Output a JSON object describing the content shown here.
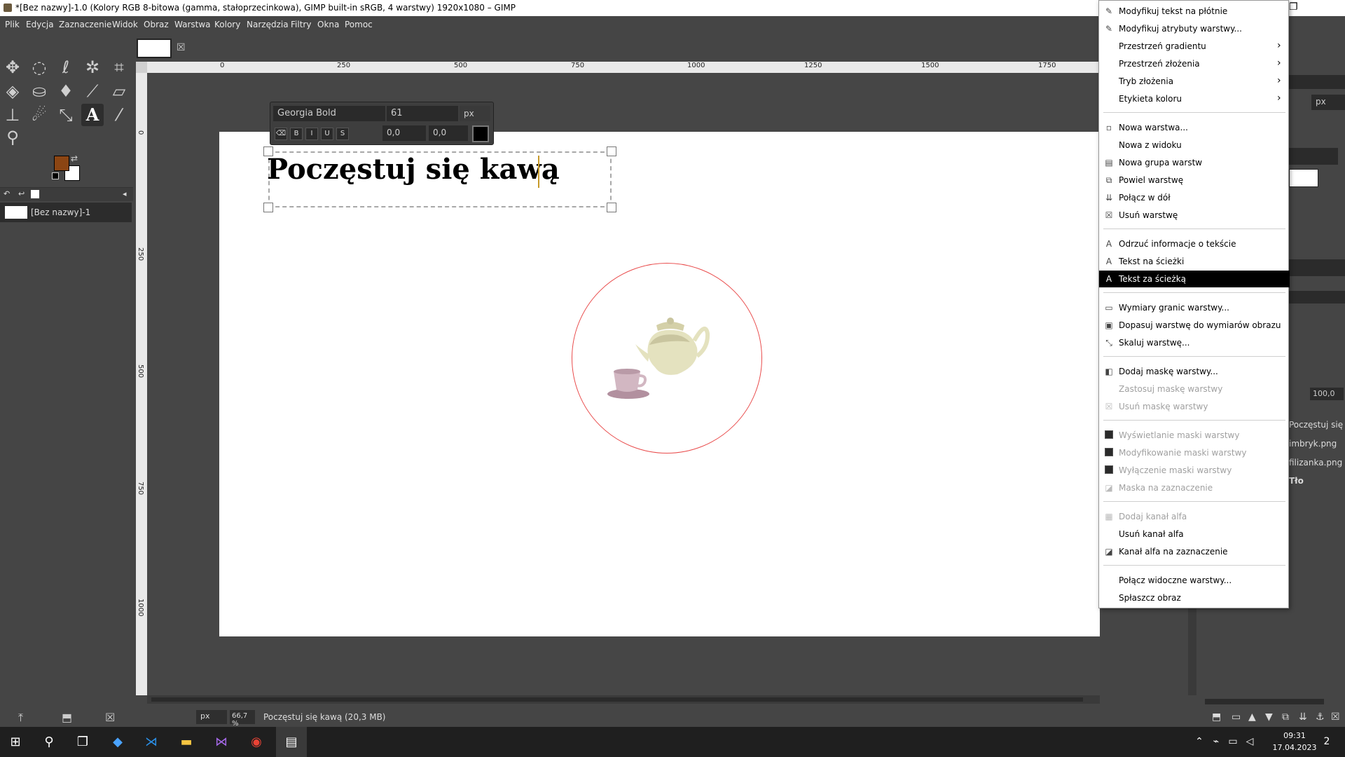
{
  "window": {
    "title": "*[Bez nazwy]-1.0 (Kolory RGB 8-bitowa (gamma, stałoprzecinkowa), GIMP built-in sRGB, 4 warstwy) 1920x1080 – GIMP",
    "restore_icon": "restore-icon"
  },
  "menubar": [
    "Plik",
    "Edycja",
    "Zaznaczenie",
    "Widok",
    "Obraz",
    "Warstwa",
    "Kolory",
    "Narzędzia",
    "Filtry",
    "Okna",
    "Pomoc"
  ],
  "toolbox": {
    "tools": [
      "move-icon",
      "ellipse-select-icon",
      "free-select-icon",
      "fuzzy-select-icon",
      "crop-icon",
      "transform-icon",
      "bucket-fill-icon",
      "ink-icon",
      "paintbrush-icon",
      "eraser-icon",
      "clone-icon",
      "smudge-icon",
      "paths-icon",
      "text-tool-icon",
      "color-picker-icon",
      "zoom-icon"
    ],
    "active_tool": "text-tool-icon",
    "fg_color": "#8b4513",
    "bg_color": "#ffffff"
  },
  "images_panel": {
    "item_label": "[Bez nazwy]-1"
  },
  "rulers": {
    "h_ticks": [
      "0",
      "250",
      "500",
      "750",
      "1000",
      "1250",
      "1500",
      "1750"
    ],
    "v_ticks": [
      "0",
      "250",
      "500",
      "750",
      "1000"
    ]
  },
  "text_tool_options": {
    "font": "Georgia Bold",
    "size": "61",
    "unit": "px",
    "kerning": "0,0",
    "baseline": "0,0",
    "color": "#000000"
  },
  "canvas": {
    "headline": "Poczęstuj się kawą"
  },
  "statusbar": {
    "unit": "px",
    "zoom": "66,7 %",
    "message": "Poczęstuj się kawą (20,3 MB)"
  },
  "right_dock": {
    "unit": "px",
    "opacity": "100,0",
    "layers": [
      "Poczęstuj się k",
      "imbryk.png",
      "filizanka.png",
      "Tło"
    ]
  },
  "context_menu": {
    "items": [
      {
        "label": "Modyfikuj tekst na płótnie",
        "icon": "edit-text-icon",
        "state": "normal"
      },
      {
        "label": "Modyfikuj atrybuty warstwy...",
        "icon": "edit-attrs-icon",
        "state": "normal"
      },
      {
        "label": "Przestrzeń gradientu",
        "icon": "",
        "state": "submenu"
      },
      {
        "label": "Przestrzeń złożenia",
        "icon": "",
        "state": "submenu"
      },
      {
        "label": "Tryb złożenia",
        "icon": "",
        "state": "submenu"
      },
      {
        "label": "Etykieta koloru",
        "icon": "",
        "state": "submenu"
      },
      {
        "label": "Nowa warstwa...",
        "icon": "new-layer-icon",
        "state": "normal"
      },
      {
        "label": "Nowa z widoku",
        "icon": "",
        "state": "normal"
      },
      {
        "label": "Nowa grupa warstw",
        "icon": "new-group-icon",
        "state": "normal"
      },
      {
        "label": "Powiel warstwę",
        "icon": "duplicate-icon",
        "state": "normal"
      },
      {
        "label": "Połącz w dół",
        "icon": "merge-down-icon",
        "state": "normal"
      },
      {
        "label": "Usuń warstwę",
        "icon": "delete-layer-icon",
        "state": "normal"
      },
      {
        "label": "Odrzuć informacje o tekście",
        "icon": "text-a-icon",
        "state": "normal"
      },
      {
        "label": "Tekst na ścieżki",
        "icon": "text-a-icon",
        "state": "normal"
      },
      {
        "label": "Tekst za ścieżką",
        "icon": "text-a-icon",
        "state": "highlighted"
      },
      {
        "label": "Wymiary granic warstwy...",
        "icon": "layer-bounds-icon",
        "state": "normal"
      },
      {
        "label": "Dopasuj warstwę do wymiarów obrazu",
        "icon": "fit-layer-icon",
        "state": "normal"
      },
      {
        "label": "Skaluj warstwę...",
        "icon": "scale-layer-icon",
        "state": "normal"
      },
      {
        "label": "Dodaj maskę warstwy...",
        "icon": "add-mask-icon",
        "state": "normal"
      },
      {
        "label": "Zastosuj maskę warstwy",
        "icon": "",
        "state": "disabled"
      },
      {
        "label": "Usuń maskę warstwy",
        "icon": "delete-mask-icon",
        "state": "disabled"
      },
      {
        "label": "Wyświetlanie maski warstwy",
        "icon": "checkbox-icon",
        "state": "disabled"
      },
      {
        "label": "Modyfikowanie maski warstwy",
        "icon": "checkbox-icon",
        "state": "disabled"
      },
      {
        "label": "Wyłączenie maski warstwy",
        "icon": "checkbox-icon",
        "state": "disabled"
      },
      {
        "label": "Maska na zaznaczenie",
        "icon": "mask-to-selection-icon",
        "state": "disabled"
      },
      {
        "label": "Dodaj kanał alfa",
        "icon": "alpha-icon",
        "state": "disabled"
      },
      {
        "label": "Usuń kanał alfa",
        "icon": "",
        "state": "normal"
      },
      {
        "label": "Kanał alfa na zaznaczenie",
        "icon": "alpha-selection-icon",
        "state": "normal"
      },
      {
        "label": "Połącz widoczne warstwy...",
        "icon": "",
        "state": "normal"
      },
      {
        "label": "Spłaszcz obraz",
        "icon": "",
        "state": "normal"
      }
    ]
  },
  "taskbar": {
    "time": "09:31",
    "date": "17.04.2023",
    "notifications": "2"
  }
}
